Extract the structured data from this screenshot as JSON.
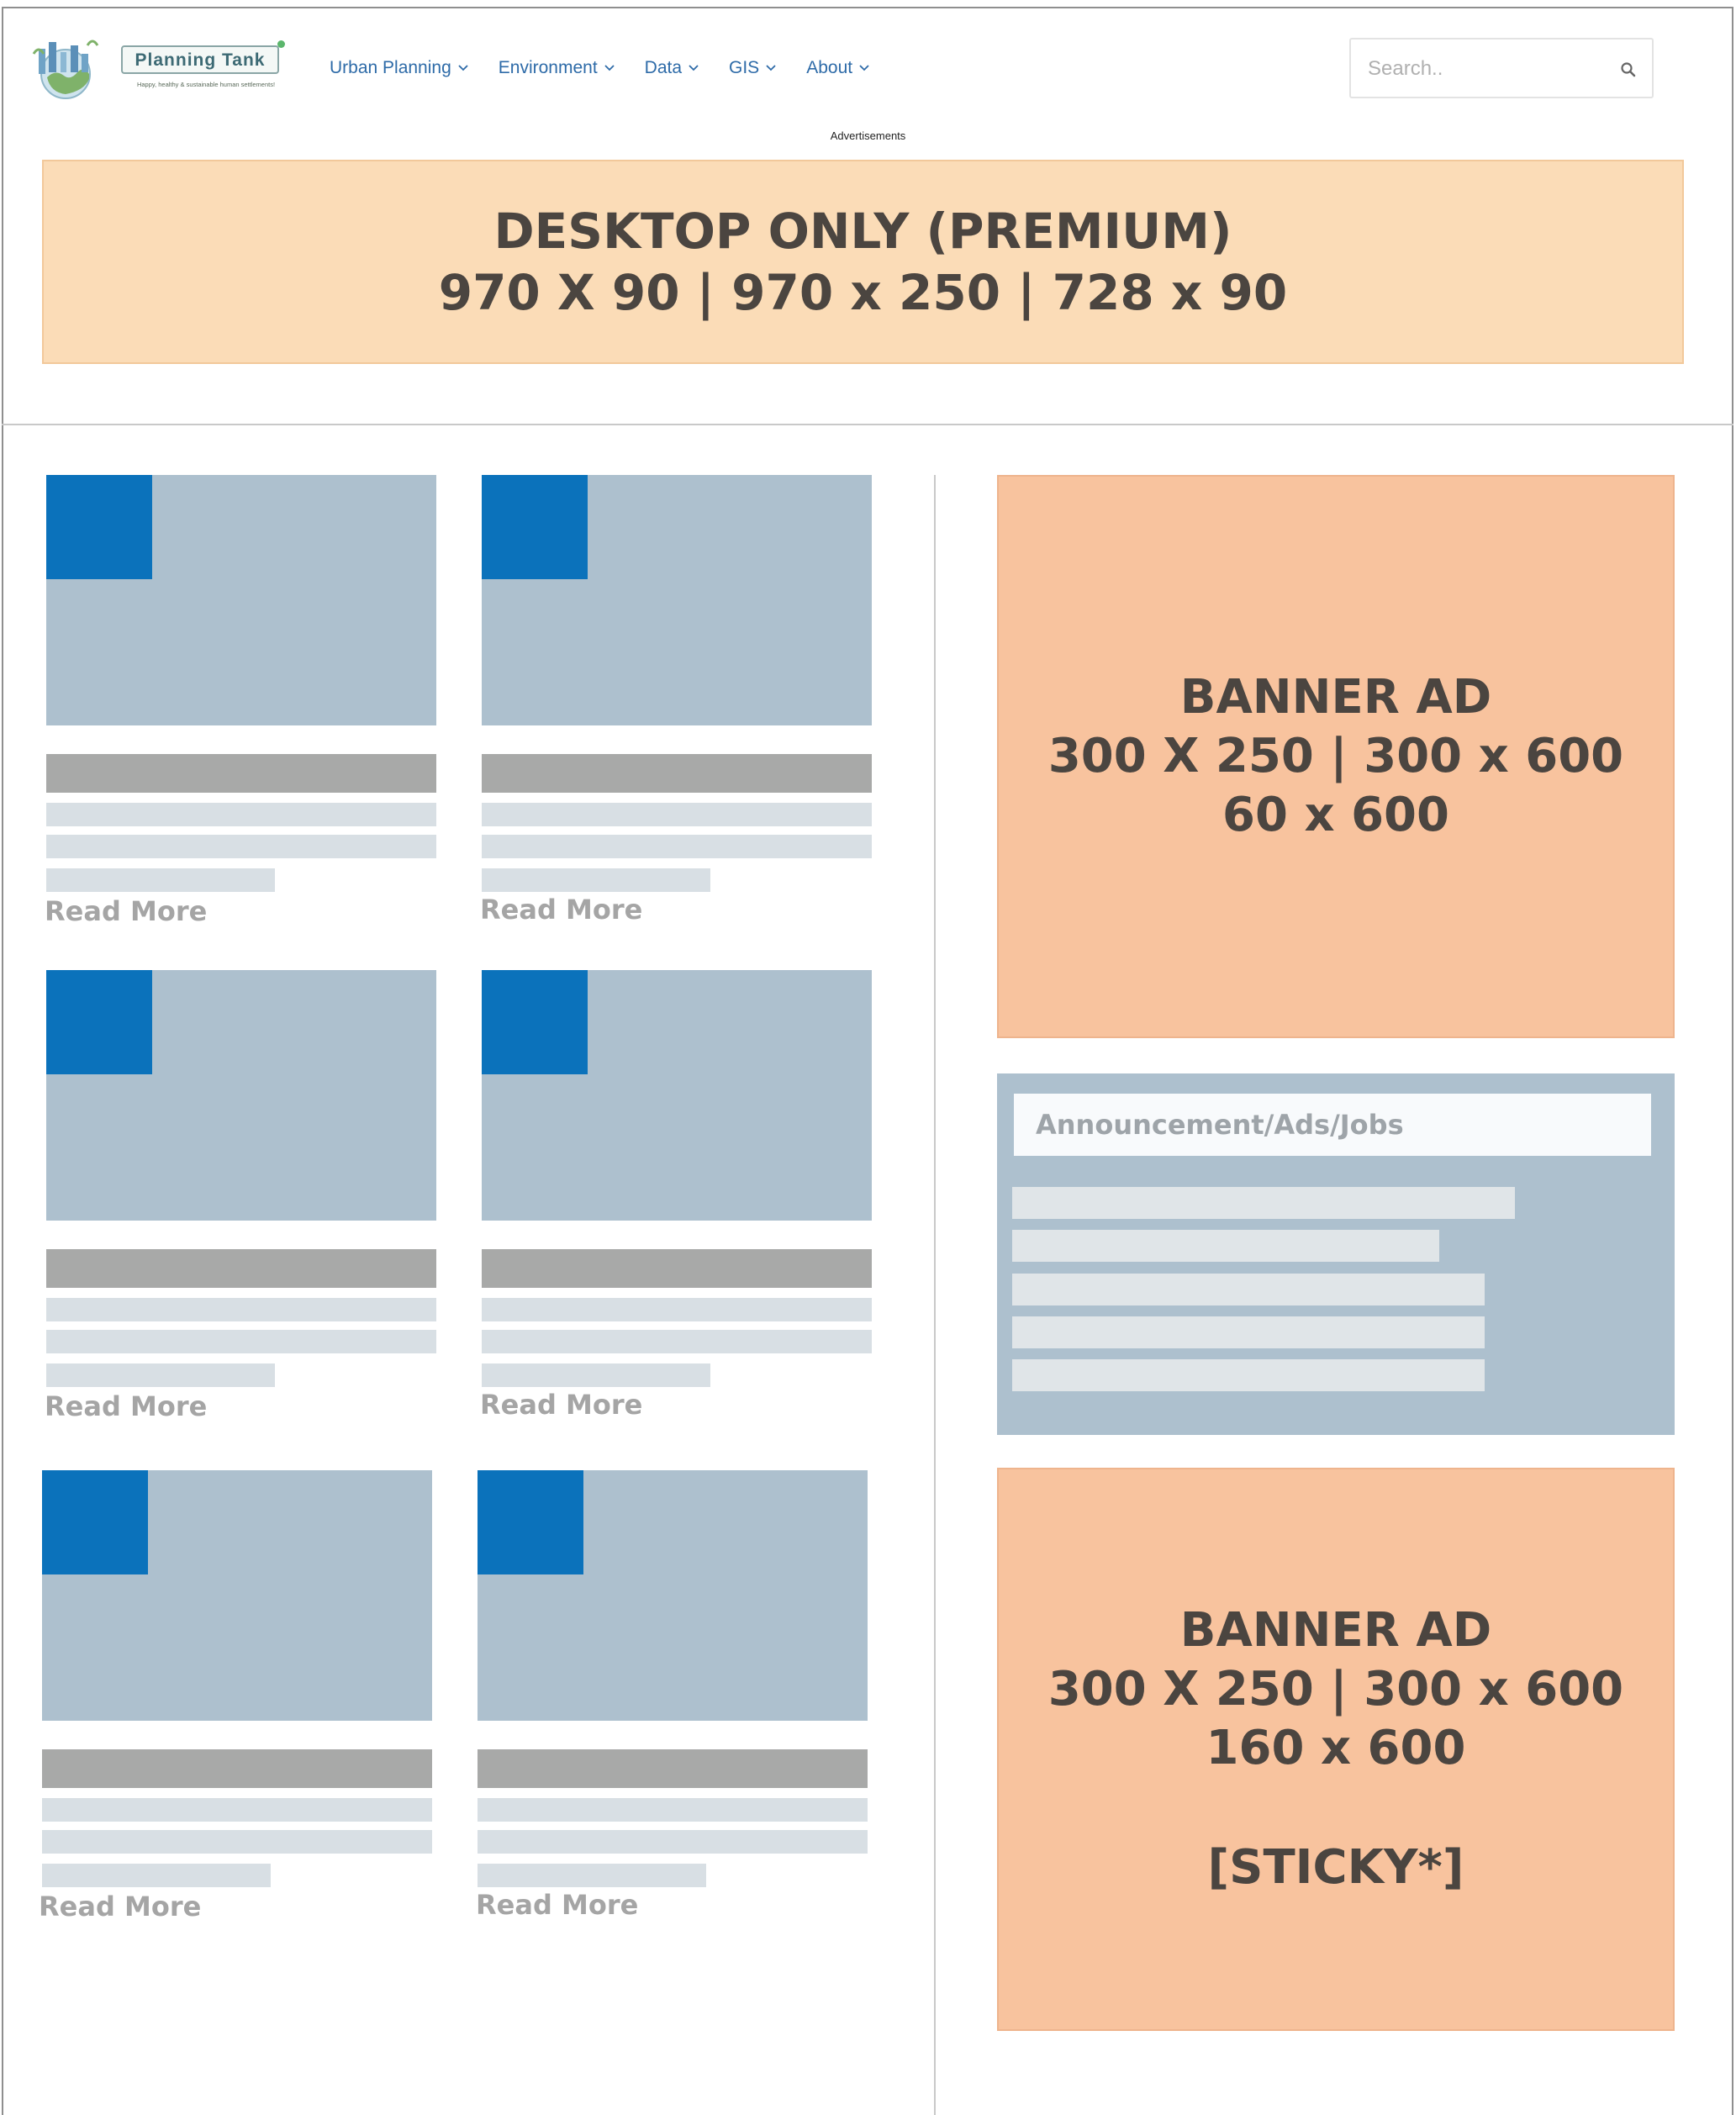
{
  "logo": {
    "title": "Planning Tank",
    "tagline": "Happy, healthy & sustainable human settlements!"
  },
  "nav": {
    "items": [
      {
        "label": "Urban Planning"
      },
      {
        "label": "Environment"
      },
      {
        "label": "Data"
      },
      {
        "label": "GIS"
      },
      {
        "label": "About"
      }
    ]
  },
  "search": {
    "placeholder": "Search.."
  },
  "ads_label": "Advertisements",
  "leaderboard": {
    "line1": "DESKTOP ONLY (PREMIUM)",
    "line2": "970 X 90 |  970 x 250 | 728 x 90"
  },
  "cards": [
    {
      "read_more": "Read More"
    },
    {
      "read_more": "Read More"
    },
    {
      "read_more": "Read More"
    },
    {
      "read_more": "Read More"
    },
    {
      "read_more": "Read More"
    },
    {
      "read_more": "Read More"
    }
  ],
  "sidebar": {
    "banner_top": {
      "line1": "BANNER AD",
      "line2": "300 X 250 | 300 x 600",
      "line3": "60 x 600"
    },
    "announcement": {
      "title": "Announcement/Ads/Jobs"
    },
    "banner_bottom": {
      "line1": "BANNER AD",
      "line2": "300 X 250 | 300 x 600",
      "line3": "160 x 600",
      "line4": "[STICKY*]"
    }
  },
  "colors": {
    "nav_link": "#2e6ba8",
    "leaderboard_bg": "#fbdcb7",
    "banner_bg": "#f8c39e",
    "thumb_bg": "#adc0ce",
    "thumb_accent": "#0b72bb",
    "placeholder_title": "#a8a9a8",
    "placeholder_line": "#d8dfe4",
    "read_more": "#a5a5a5"
  }
}
